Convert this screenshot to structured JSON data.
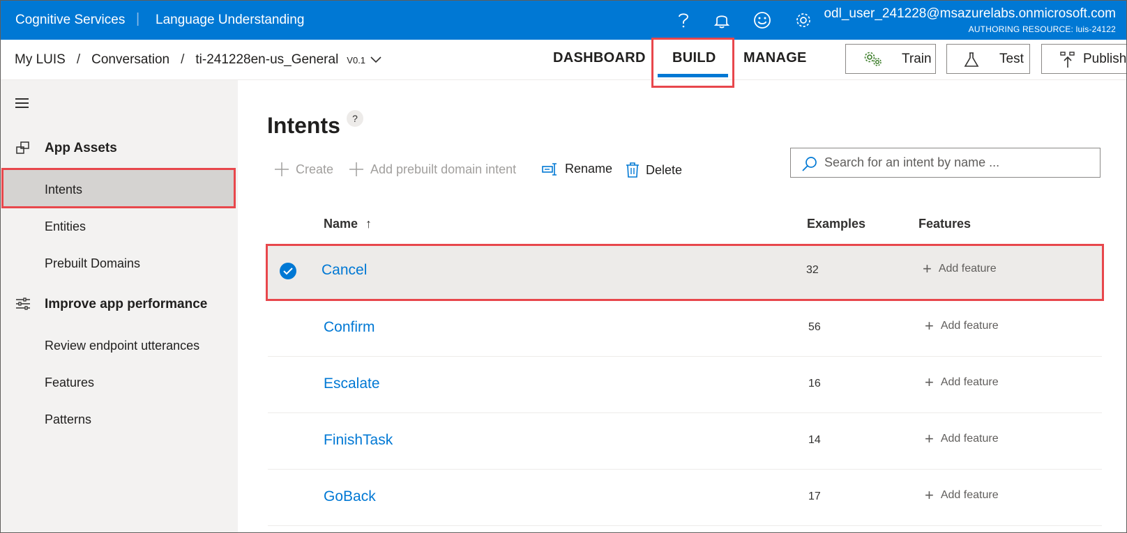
{
  "topbar": {
    "brand": "Cognitive Services",
    "separator": "|",
    "app_name": "Language Understanding",
    "user_email": "odl_user_241228@msazurelabs.onmicrosoft.com",
    "authoring_resource": "AUTHORING RESOURCE:  luis-24122",
    "icons": [
      "help-icon",
      "bell-icon",
      "smiley-icon",
      "gear-icon"
    ],
    "accent_color": "#0078d4"
  },
  "breadcrumb": {
    "items": [
      "My LUIS",
      "Conversation",
      "ti-241228en-us_General"
    ],
    "separator": "/",
    "version": "V0.1"
  },
  "tabs": {
    "dashboard": "DASHBOARD",
    "build": "BUILD",
    "manage": "MANAGE",
    "active": "BUILD"
  },
  "actions": {
    "train": "Train",
    "test": "Test",
    "publish": "Publish"
  },
  "sidebar": {
    "sections": [
      {
        "title": "App Assets",
        "items": [
          "Intents",
          "Entities",
          "Prebuilt Domains"
        ]
      },
      {
        "title": "Improve app performance",
        "items": [
          "Review endpoint utterances",
          "Features",
          "Patterns"
        ]
      }
    ],
    "selected": "Intents"
  },
  "main": {
    "title": "Intents",
    "help": "?",
    "toolbar": {
      "create": "Create",
      "add_prebuilt": "Add prebuilt domain intent",
      "rename": "Rename",
      "delete": "Delete"
    },
    "search_placeholder": "Search for an intent by name ...",
    "columns": {
      "name": "Name",
      "sort_indicator": "↑",
      "examples": "Examples",
      "features": "Features"
    },
    "rows": [
      {
        "name": "Cancel",
        "examples": "32",
        "feature_action": "Add feature",
        "selected": true
      },
      {
        "name": "Confirm",
        "examples": "56",
        "feature_action": "Add feature",
        "selected": false
      },
      {
        "name": "Escalate",
        "examples": "16",
        "feature_action": "Add feature",
        "selected": false
      },
      {
        "name": "FinishTask",
        "examples": "14",
        "feature_action": "Add feature",
        "selected": false
      },
      {
        "name": "GoBack",
        "examples": "17",
        "feature_action": "Add feature",
        "selected": false
      }
    ]
  },
  "highlight_color": "#e8474c"
}
